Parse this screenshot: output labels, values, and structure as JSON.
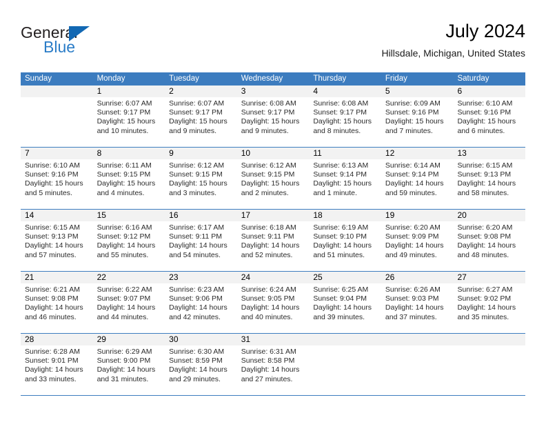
{
  "brand": {
    "name_top": "General",
    "name_bottom": "Blue",
    "accent_color": "#1268b3"
  },
  "header": {
    "title": "July 2024",
    "subtitle": "Hillsdale, Michigan, United States"
  },
  "theme": {
    "header_row_bg": "#3c7cbf",
    "daynum_band_bg": "#f2f2f2",
    "rule_color": "#3c7cbf"
  },
  "weekdays": [
    "Sunday",
    "Monday",
    "Tuesday",
    "Wednesday",
    "Thursday",
    "Friday",
    "Saturday"
  ],
  "weeks": [
    {
      "days": [
        {
          "num": "",
          "sunrise": "",
          "sunset": "",
          "daylight1": "",
          "daylight2": ""
        },
        {
          "num": "1",
          "sunrise": "Sunrise: 6:07 AM",
          "sunset": "Sunset: 9:17 PM",
          "daylight1": "Daylight: 15 hours",
          "daylight2": "and 10 minutes."
        },
        {
          "num": "2",
          "sunrise": "Sunrise: 6:07 AM",
          "sunset": "Sunset: 9:17 PM",
          "daylight1": "Daylight: 15 hours",
          "daylight2": "and 9 minutes."
        },
        {
          "num": "3",
          "sunrise": "Sunrise: 6:08 AM",
          "sunset": "Sunset: 9:17 PM",
          "daylight1": "Daylight: 15 hours",
          "daylight2": "and 9 minutes."
        },
        {
          "num": "4",
          "sunrise": "Sunrise: 6:08 AM",
          "sunset": "Sunset: 9:17 PM",
          "daylight1": "Daylight: 15 hours",
          "daylight2": "and 8 minutes."
        },
        {
          "num": "5",
          "sunrise": "Sunrise: 6:09 AM",
          "sunset": "Sunset: 9:16 PM",
          "daylight1": "Daylight: 15 hours",
          "daylight2": "and 7 minutes."
        },
        {
          "num": "6",
          "sunrise": "Sunrise: 6:10 AM",
          "sunset": "Sunset: 9:16 PM",
          "daylight1": "Daylight: 15 hours",
          "daylight2": "and 6 minutes."
        }
      ]
    },
    {
      "days": [
        {
          "num": "7",
          "sunrise": "Sunrise: 6:10 AM",
          "sunset": "Sunset: 9:16 PM",
          "daylight1": "Daylight: 15 hours",
          "daylight2": "and 5 minutes."
        },
        {
          "num": "8",
          "sunrise": "Sunrise: 6:11 AM",
          "sunset": "Sunset: 9:15 PM",
          "daylight1": "Daylight: 15 hours",
          "daylight2": "and 4 minutes."
        },
        {
          "num": "9",
          "sunrise": "Sunrise: 6:12 AM",
          "sunset": "Sunset: 9:15 PM",
          "daylight1": "Daylight: 15 hours",
          "daylight2": "and 3 minutes."
        },
        {
          "num": "10",
          "sunrise": "Sunrise: 6:12 AM",
          "sunset": "Sunset: 9:15 PM",
          "daylight1": "Daylight: 15 hours",
          "daylight2": "and 2 minutes."
        },
        {
          "num": "11",
          "sunrise": "Sunrise: 6:13 AM",
          "sunset": "Sunset: 9:14 PM",
          "daylight1": "Daylight: 15 hours",
          "daylight2": "and 1 minute."
        },
        {
          "num": "12",
          "sunrise": "Sunrise: 6:14 AM",
          "sunset": "Sunset: 9:14 PM",
          "daylight1": "Daylight: 14 hours",
          "daylight2": "and 59 minutes."
        },
        {
          "num": "13",
          "sunrise": "Sunrise: 6:15 AM",
          "sunset": "Sunset: 9:13 PM",
          "daylight1": "Daylight: 14 hours",
          "daylight2": "and 58 minutes."
        }
      ]
    },
    {
      "days": [
        {
          "num": "14",
          "sunrise": "Sunrise: 6:15 AM",
          "sunset": "Sunset: 9:13 PM",
          "daylight1": "Daylight: 14 hours",
          "daylight2": "and 57 minutes."
        },
        {
          "num": "15",
          "sunrise": "Sunrise: 6:16 AM",
          "sunset": "Sunset: 9:12 PM",
          "daylight1": "Daylight: 14 hours",
          "daylight2": "and 55 minutes."
        },
        {
          "num": "16",
          "sunrise": "Sunrise: 6:17 AM",
          "sunset": "Sunset: 9:11 PM",
          "daylight1": "Daylight: 14 hours",
          "daylight2": "and 54 minutes."
        },
        {
          "num": "17",
          "sunrise": "Sunrise: 6:18 AM",
          "sunset": "Sunset: 9:11 PM",
          "daylight1": "Daylight: 14 hours",
          "daylight2": "and 52 minutes."
        },
        {
          "num": "18",
          "sunrise": "Sunrise: 6:19 AM",
          "sunset": "Sunset: 9:10 PM",
          "daylight1": "Daylight: 14 hours",
          "daylight2": "and 51 minutes."
        },
        {
          "num": "19",
          "sunrise": "Sunrise: 6:20 AM",
          "sunset": "Sunset: 9:09 PM",
          "daylight1": "Daylight: 14 hours",
          "daylight2": "and 49 minutes."
        },
        {
          "num": "20",
          "sunrise": "Sunrise: 6:20 AM",
          "sunset": "Sunset: 9:08 PM",
          "daylight1": "Daylight: 14 hours",
          "daylight2": "and 48 minutes."
        }
      ]
    },
    {
      "days": [
        {
          "num": "21",
          "sunrise": "Sunrise: 6:21 AM",
          "sunset": "Sunset: 9:08 PM",
          "daylight1": "Daylight: 14 hours",
          "daylight2": "and 46 minutes."
        },
        {
          "num": "22",
          "sunrise": "Sunrise: 6:22 AM",
          "sunset": "Sunset: 9:07 PM",
          "daylight1": "Daylight: 14 hours",
          "daylight2": "and 44 minutes."
        },
        {
          "num": "23",
          "sunrise": "Sunrise: 6:23 AM",
          "sunset": "Sunset: 9:06 PM",
          "daylight1": "Daylight: 14 hours",
          "daylight2": "and 42 minutes."
        },
        {
          "num": "24",
          "sunrise": "Sunrise: 6:24 AM",
          "sunset": "Sunset: 9:05 PM",
          "daylight1": "Daylight: 14 hours",
          "daylight2": "and 40 minutes."
        },
        {
          "num": "25",
          "sunrise": "Sunrise: 6:25 AM",
          "sunset": "Sunset: 9:04 PM",
          "daylight1": "Daylight: 14 hours",
          "daylight2": "and 39 minutes."
        },
        {
          "num": "26",
          "sunrise": "Sunrise: 6:26 AM",
          "sunset": "Sunset: 9:03 PM",
          "daylight1": "Daylight: 14 hours",
          "daylight2": "and 37 minutes."
        },
        {
          "num": "27",
          "sunrise": "Sunrise: 6:27 AM",
          "sunset": "Sunset: 9:02 PM",
          "daylight1": "Daylight: 14 hours",
          "daylight2": "and 35 minutes."
        }
      ]
    },
    {
      "days": [
        {
          "num": "28",
          "sunrise": "Sunrise: 6:28 AM",
          "sunset": "Sunset: 9:01 PM",
          "daylight1": "Daylight: 14 hours",
          "daylight2": "and 33 minutes."
        },
        {
          "num": "29",
          "sunrise": "Sunrise: 6:29 AM",
          "sunset": "Sunset: 9:00 PM",
          "daylight1": "Daylight: 14 hours",
          "daylight2": "and 31 minutes."
        },
        {
          "num": "30",
          "sunrise": "Sunrise: 6:30 AM",
          "sunset": "Sunset: 8:59 PM",
          "daylight1": "Daylight: 14 hours",
          "daylight2": "and 29 minutes."
        },
        {
          "num": "31",
          "sunrise": "Sunrise: 6:31 AM",
          "sunset": "Sunset: 8:58 PM",
          "daylight1": "Daylight: 14 hours",
          "daylight2": "and 27 minutes."
        },
        {
          "num": "",
          "sunrise": "",
          "sunset": "",
          "daylight1": "",
          "daylight2": ""
        },
        {
          "num": "",
          "sunrise": "",
          "sunset": "",
          "daylight1": "",
          "daylight2": ""
        },
        {
          "num": "",
          "sunrise": "",
          "sunset": "",
          "daylight1": "",
          "daylight2": ""
        }
      ]
    }
  ]
}
